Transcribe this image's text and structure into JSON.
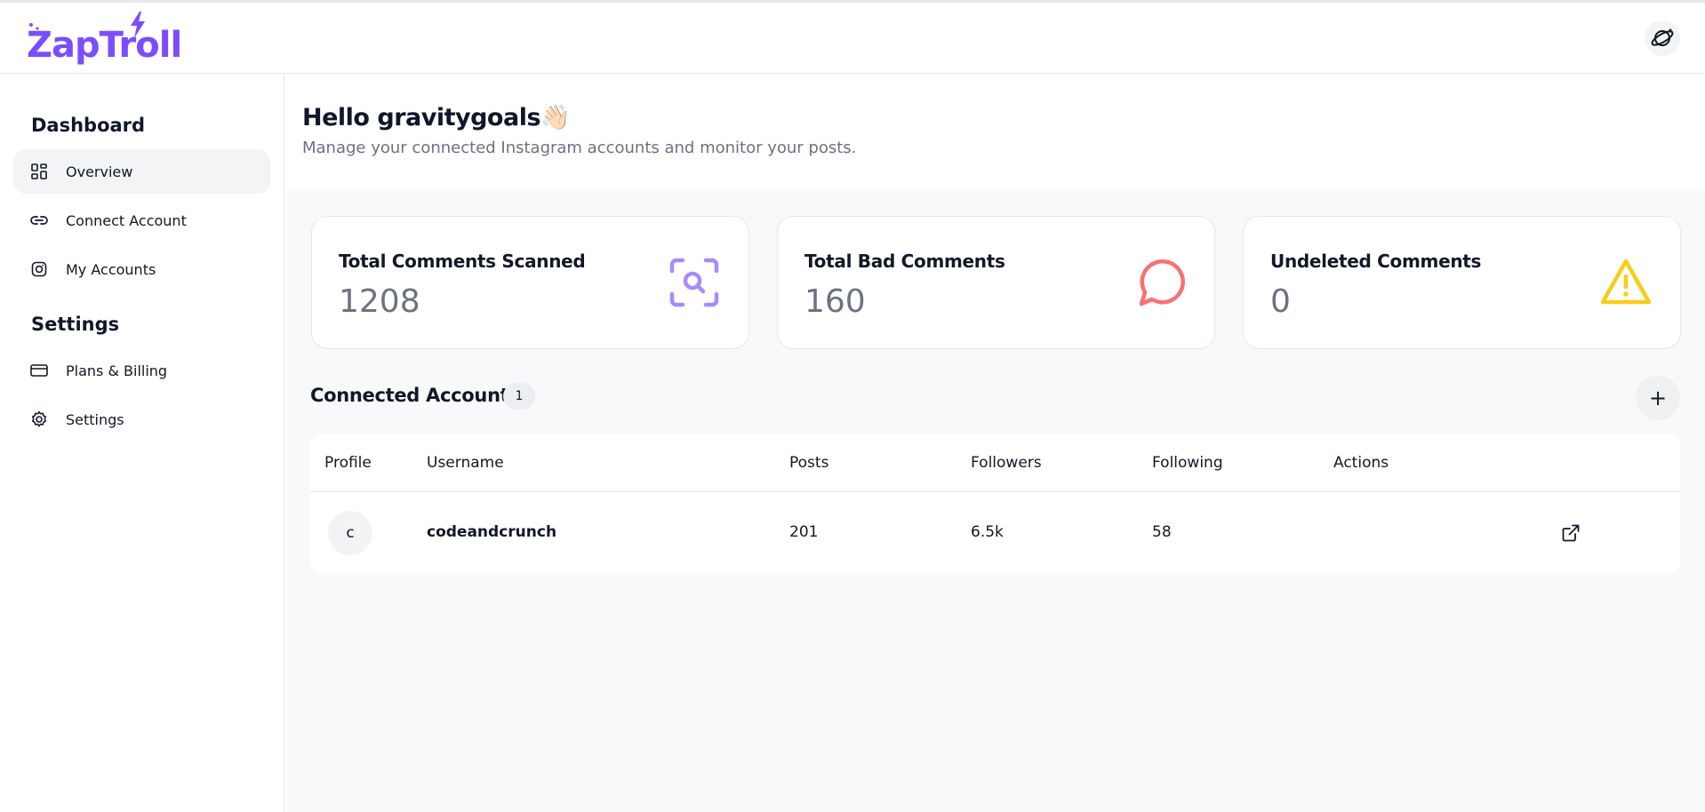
{
  "app": {
    "logo_text": "ZapTroll",
    "brand_color": "#7c4dff",
    "avatar_icon": "planet-icon"
  },
  "sidebar": {
    "sections": [
      {
        "title": "Dashboard",
        "items": [
          {
            "label": "Overview",
            "icon": "grid-icon",
            "active": true
          },
          {
            "label": "Connect Account",
            "icon": "link-icon",
            "active": false
          },
          {
            "label": "My Accounts",
            "icon": "instagram-icon",
            "active": false
          }
        ]
      },
      {
        "title": "Settings",
        "items": [
          {
            "label": "Plans & Billing",
            "icon": "credit-card-icon",
            "active": false
          },
          {
            "label": "Settings",
            "icon": "gear-icon",
            "active": false
          }
        ]
      }
    ]
  },
  "greeting": {
    "title": "Hello gravitygoals",
    "emoji": "👋🏻",
    "subtitle": "Manage your connected Instagram accounts and monitor your posts."
  },
  "stats": [
    {
      "label": "Total Comments Scanned",
      "value": "1208",
      "icon": "scan-search-icon",
      "color": "#a78bfa"
    },
    {
      "label": "Total Bad Comments",
      "value": "160",
      "icon": "message-circle-icon",
      "color": "#f87171"
    },
    {
      "label": "Undeleted Comments",
      "value": "0",
      "icon": "warning-triangle-icon",
      "color": "#facc15"
    }
  ],
  "connected": {
    "title": "Connected Accounts",
    "count": "1",
    "add_label": "+",
    "columns": [
      "Profile",
      "Username",
      "Posts",
      "Followers",
      "Following",
      "Actions"
    ],
    "rows": [
      {
        "profile_initial": "c",
        "username": "codeandcrunch",
        "posts": "201",
        "followers": "6.5k",
        "following": "58",
        "action_icon": "external-link-icon"
      }
    ]
  }
}
